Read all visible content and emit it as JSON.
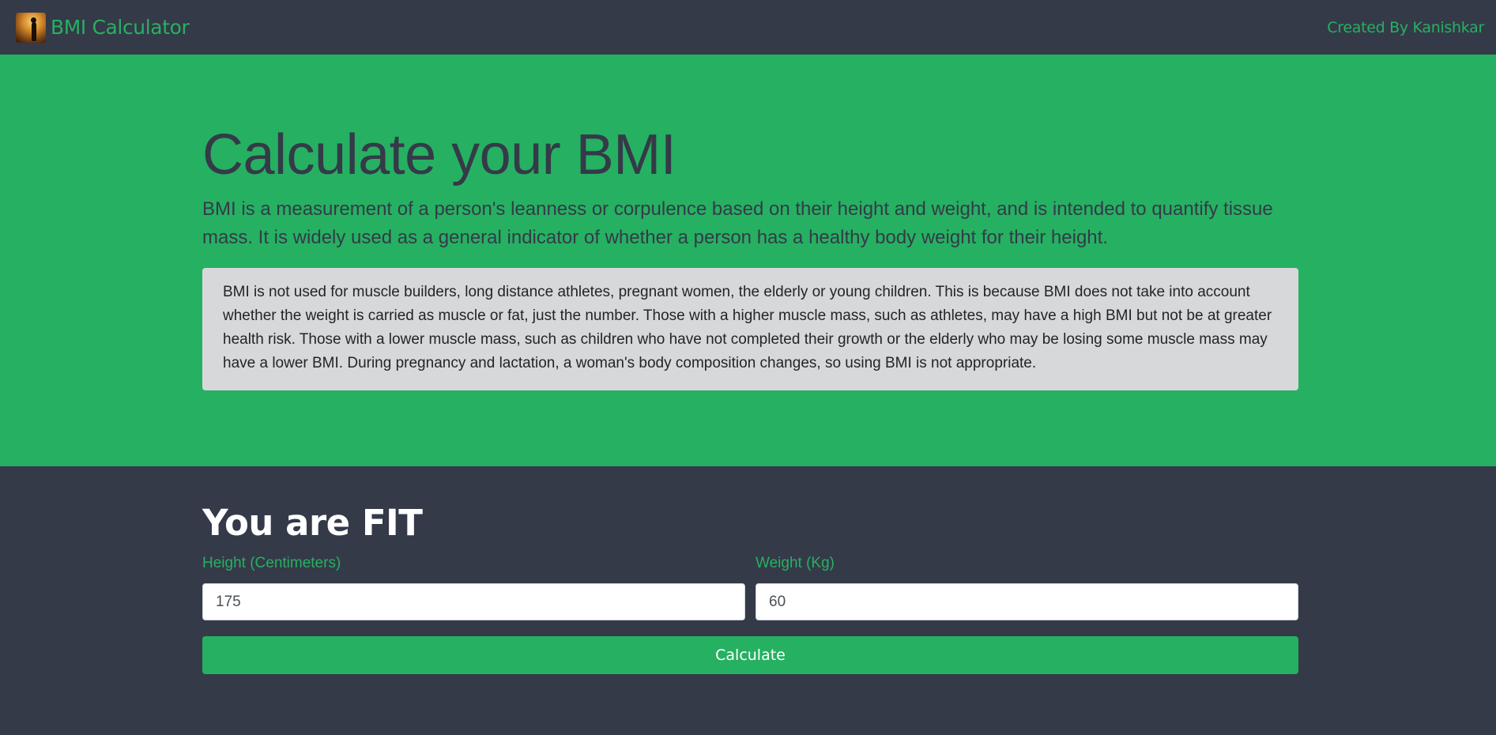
{
  "navbar": {
    "brand_text": "BMI Calculator",
    "author_link": "Created By Kanishkar"
  },
  "hero": {
    "title": "Calculate your BMI",
    "lead": "BMI is a measurement of a person's leanness or corpulence based on their height and weight, and is intended to quantify tissue mass. It is widely used as a general indicator of whether a person has a healthy body weight for their height.",
    "note": "BMI is not used for muscle builders, long distance athletes, pregnant women, the elderly or young children. This is because BMI does not take into account whether the weight is carried as muscle or fat, just the number. Those with a higher muscle mass, such as athletes, may have a high BMI but not be at greater health risk. Those with a lower muscle mass, such as children who have not completed their growth or the elderly who may be losing some muscle mass may have a lower BMI. During pregnancy and lactation, a woman's body composition changes, so using BMI is not appropriate."
  },
  "form": {
    "result": "You are FIT",
    "height": {
      "label": "Height (Centimeters)",
      "value": "175"
    },
    "weight": {
      "label": "Weight (Kg)",
      "value": "60"
    },
    "submit_label": "Calculate"
  },
  "colors": {
    "brand_green": "#26b062",
    "dark_bg": "#343a48",
    "note_bg": "#d7d8da"
  }
}
